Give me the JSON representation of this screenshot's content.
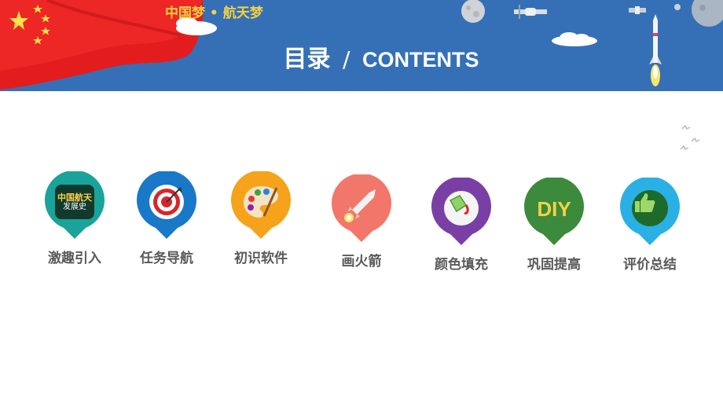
{
  "header": {
    "slogan": "中国梦 • 航天梦",
    "title_cn": "目录",
    "title_sep": "/",
    "title_en": "CONTENTS"
  },
  "colors": {
    "header_bg": "#3570b6",
    "flag_red": "#e31d1d",
    "slogan": "#f5d142",
    "label_text": "#595959"
  },
  "menu": [
    {
      "label": "激趣引入",
      "color": "#1aa39a",
      "icon": "china-space-dream-badge-icon",
      "badge_lines": [
        "中国航天",
        "发展史"
      ]
    },
    {
      "label": "任务导航",
      "color": "#1978c8",
      "icon": "target-icon"
    },
    {
      "label": "初识软件",
      "color": "#f6a21a",
      "icon": "palette-icon"
    },
    {
      "label": "画火箭",
      "color": "#f2766a",
      "icon": "rocket-icon"
    },
    {
      "label": "颜色填充",
      "color": "#7a3fa5",
      "icon": "paint-bucket-icon"
    },
    {
      "label": "巩固提高",
      "color": "#3c8a3c",
      "icon": "diy-icon",
      "icon_text": "DIY"
    },
    {
      "label": "评价总结",
      "color": "#2bb0e6",
      "icon": "thumbs-up-icon"
    }
  ]
}
